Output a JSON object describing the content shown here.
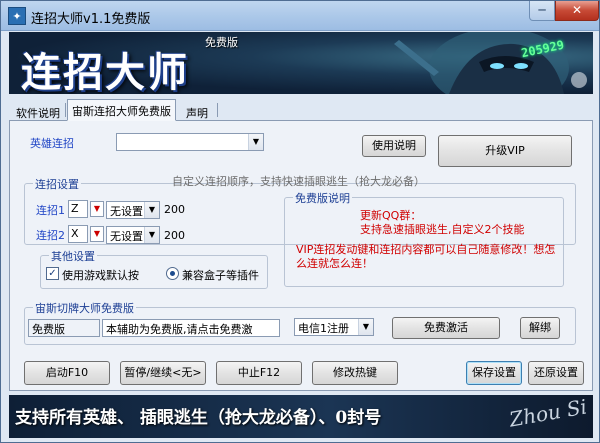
{
  "window": {
    "title": "连招大师v1.1免费版",
    "min_label": "─",
    "close_label": "✕"
  },
  "banner": {
    "title": "连招大师",
    "badge": "免费版",
    "qq_text": "205929"
  },
  "tabs": [
    {
      "label": "软件说明"
    },
    {
      "label": "宙斯连招大师免费版"
    },
    {
      "label": "声明"
    }
  ],
  "hero": {
    "label": "英雄连招",
    "select_value": "",
    "help_button": "使用说明",
    "upgrade_button": "升级VIP"
  },
  "combo_settings": {
    "title": "连招设置",
    "hint": "自定义连招顺序，支持快速插眼逃生（抢大龙必备）",
    "rows": [
      {
        "label": "连招1",
        "key": "Z",
        "mode": "无设置",
        "value": "200"
      },
      {
        "label": "连招2",
        "key": "X",
        "mode": "无设置",
        "value": "200"
      }
    ]
  },
  "other_settings": {
    "title": "其他设置",
    "checkbox_label": "使用游戏默认按",
    "radio_label": "兼容盒子等插件"
  },
  "free_info": {
    "title": "免费版说明",
    "qq_line": "更新QQ群：",
    "feature_line": "支持急速插眼逃生,自定义2个技能",
    "vip_line": "VIP连招发动键和连招内容都可以自己随意修改！想怎么连就怎么连！"
  },
  "activation": {
    "title": "宙斯切牌大师免费版",
    "version_field": "免费版",
    "notice_field": "本辅助为免费版,请点击免费激",
    "server_value": "电信1注册",
    "activate_button": "免费激活",
    "unbind_button": "解绑"
  },
  "bottom_buttons": {
    "start": "启动F10",
    "pause": "暂停/继续<无>",
    "stop": "中止F12",
    "hotkey": "修改热键",
    "save": "保存设置",
    "restore": "还原设置"
  },
  "footer": {
    "slogan": "支持所有英雄、 插眼逃生（抢大龙必备）、0封号",
    "signature": "Zhou Si"
  }
}
